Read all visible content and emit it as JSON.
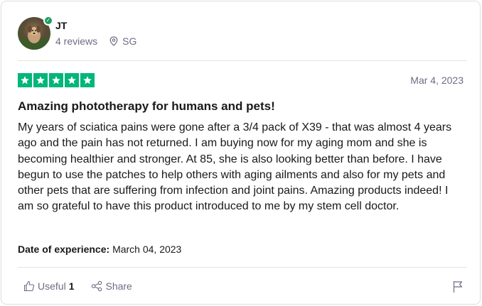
{
  "reviewer": {
    "name": "JT",
    "reviews_count": "4 reviews",
    "location": "SG",
    "verified": true,
    "icons": {
      "avatar": "dog-photo-avatar",
      "verified": "checkmark-icon",
      "location": "location-pin-icon"
    }
  },
  "review": {
    "rating": 5,
    "rating_max": 5,
    "star_color": "#00b67a",
    "date": "Mar 4, 2023",
    "title": "Amazing phototherapy for humans and pets!",
    "body": "My years of sciatica pains were gone after a 3/4 pack of X39 - that was almost 4 years ago and the pain has not returned. I am buying now for my aging mom and she is becoming healthier and stronger. At 85, she is also looking better than before. I have begun to use the patches to help others with aging ailments and also for my pets and other pets that are suffering from infection and joint pains. Amazing products indeed! I am so grateful to have this product introduced to me by my stem cell doctor.",
    "experience_label": "Date of experience:",
    "experience_date": "March 04, 2023"
  },
  "actions": {
    "useful_label": "Useful",
    "useful_count": "1",
    "share_label": "Share",
    "icons": {
      "useful": "thumbs-up-icon",
      "share": "share-icon",
      "report": "flag-icon"
    }
  }
}
